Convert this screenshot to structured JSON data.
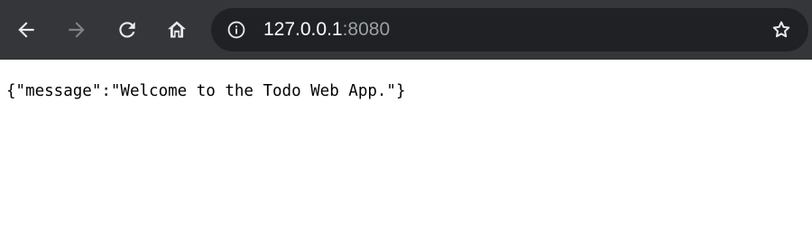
{
  "toolbar": {
    "back": {
      "icon": "arrow-left-icon",
      "enabled": true
    },
    "forward": {
      "icon": "arrow-right-icon",
      "enabled": false
    },
    "reload": {
      "icon": "reload-icon"
    },
    "home": {
      "icon": "home-icon"
    },
    "address_bar": {
      "info_icon": "info-icon",
      "host": "127.0.0.1",
      "port": ":8080",
      "bookmark_icon": "star-icon"
    }
  },
  "page": {
    "body_text": "{\"message\":\"Welcome to the Todo Web App.\"}"
  },
  "colors": {
    "toolbar_bg": "#35363a",
    "omnibox_bg": "#202124",
    "icon_active": "#e8eaed",
    "icon_disabled": "#7f8185",
    "url_host": "#ffffff",
    "url_port": "#9aa0a6",
    "page_bg": "#ffffff",
    "page_text": "#000000"
  }
}
